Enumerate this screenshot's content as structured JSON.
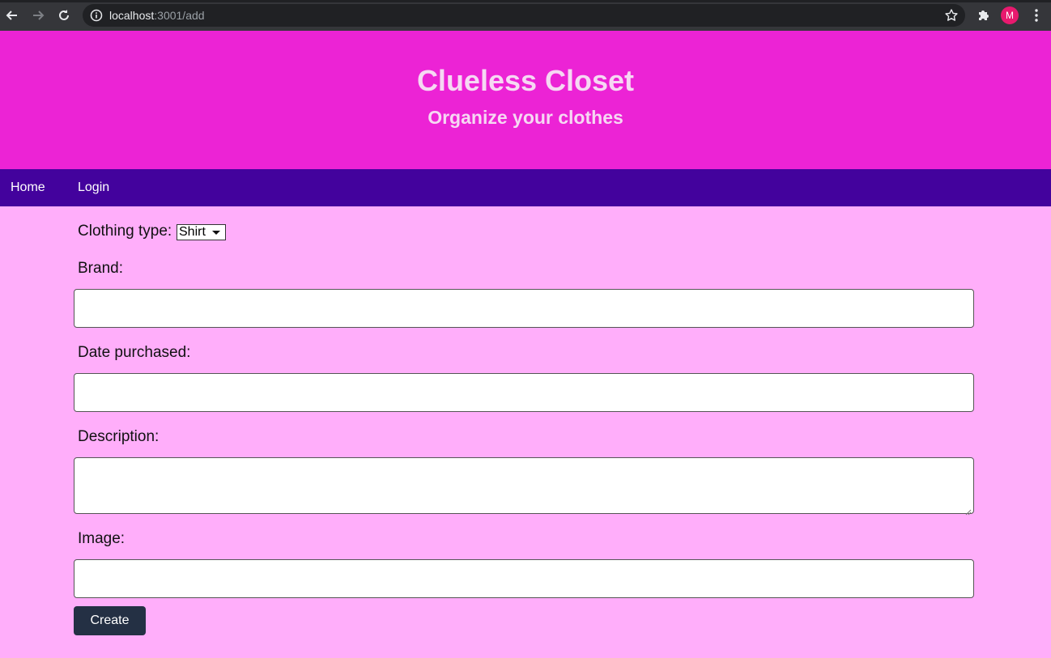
{
  "browser": {
    "url_host": "localhost",
    "url_rest": ":3001/add",
    "avatar_letter": "M",
    "icons": [
      "back-icon",
      "forward-icon",
      "reload-icon",
      "info-icon",
      "star-icon",
      "extensions-icon",
      "menu-dots-icon"
    ]
  },
  "header": {
    "title": "Clueless Closet",
    "subtitle": "Organize your clothes"
  },
  "nav": {
    "items": [
      {
        "label": "Home"
      },
      {
        "label": "Login"
      }
    ]
  },
  "form": {
    "clothing_type_label": "Clothing type:",
    "clothing_type_value": "Shirt",
    "brand_label": "Brand:",
    "brand_value": "",
    "date_label": "Date purchased:",
    "date_value": "",
    "description_label": "Description:",
    "description_value": "",
    "image_label": "Image:",
    "image_value": "",
    "submit_label": "Create"
  },
  "colors": {
    "header_bg": "#ec23d5",
    "nav_bg": "#43029d",
    "page_bg": "#ffaefa",
    "button_bg": "#243044",
    "avatar_bg": "#e8196e"
  }
}
